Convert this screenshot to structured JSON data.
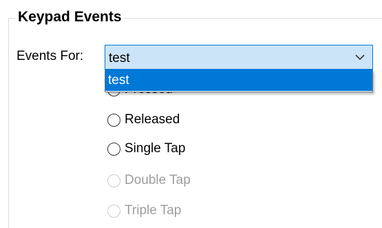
{
  "group": {
    "title": "Keypad Events"
  },
  "events_for": {
    "label": "Events For:",
    "selected_value": "test",
    "options": [
      "test"
    ]
  },
  "radios": [
    {
      "label": "Pressed",
      "enabled": true
    },
    {
      "label": "Released",
      "enabled": true
    },
    {
      "label": "Single Tap",
      "enabled": true
    },
    {
      "label": "Double Tap",
      "enabled": false
    },
    {
      "label": "Triple Tap",
      "enabled": false
    }
  ],
  "colors": {
    "combo_focus_bg": "#cce4f7",
    "selection_blue": "#0078d7",
    "disabled_text": "#9d9d9d"
  },
  "icons": {
    "combo_arrow": "chevron-down-icon"
  }
}
